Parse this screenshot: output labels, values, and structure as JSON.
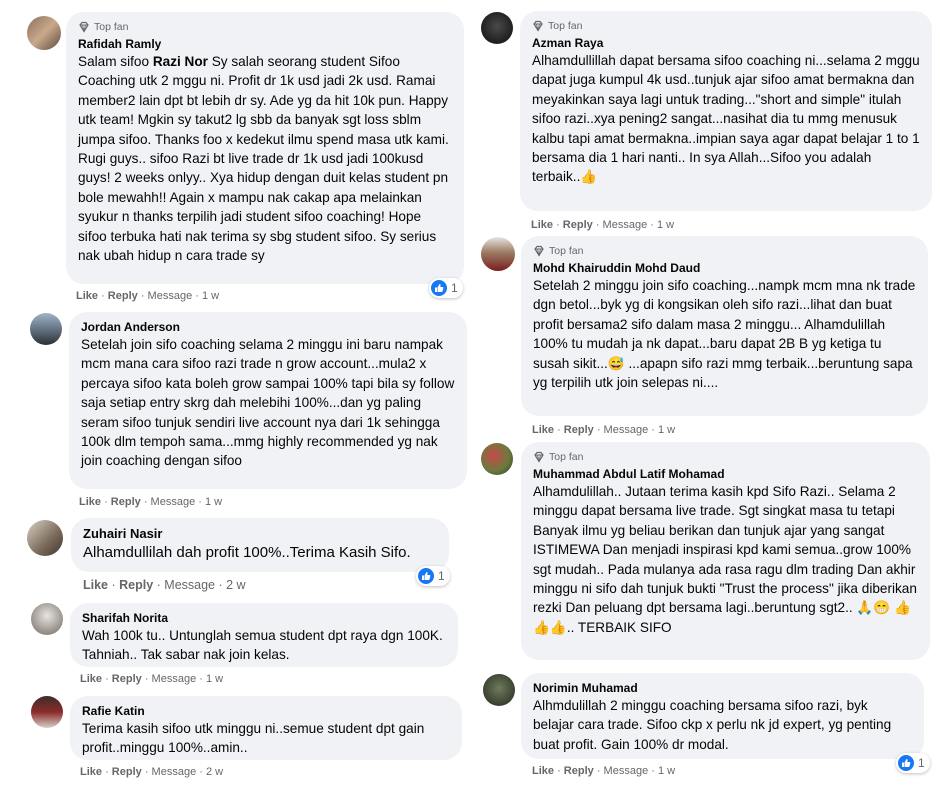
{
  "badge_label": "Top fan",
  "colors": {
    "bubble": "#f0f2f5",
    "like_blue": "#1877f2",
    "meta": "#65676b"
  },
  "comments": [
    {
      "name": "Rafidah Ramly",
      "mention": "Razi Nor",
      "text_prefix": "Salam sifoo ",
      "text": " Sy salah seorang student Sifoo Coaching utk 2 mggu ni. Profit dr 1k usd jadi 2k usd. Ramai member2 lain dpt bt lebih dr sy. Ade yg da hit 10k pun. Happy utk team! Mgkin sy takut2 lg sbb da banyak sgt loss sblm jumpa sifoo. Thanks foo x kedekut ilmu spend masa utk kami. Rugi guys.. sifoo Razi bt live trade dr 1k usd jadi 100kusd guys! 2 weeks onlyy.. Xya hidup dengan duit kelas student pn bole mewahh!! Again x mampu nak cakap apa melainkan syukur n thanks terpilih jadi student sifoo coaching! Hope sifoo terbuka hati nak terima sy sbg student sifoo. Sy serius nak ubah hidup n cara trade sy",
      "like": "Like",
      "reply": "Reply",
      "message": "Message",
      "time": "1 w",
      "reactions": "1"
    },
    {
      "name": "Jordan Anderson",
      "text": "Setelah join sifo coaching selama 2 minggu ini baru nampak mcm mana cara sifoo razi trade n grow account...mula2 x percaya sifoo kata boleh grow sampai 100% tapi bila sy follow saja setiap entry skrg dah melebihi 100%...dan yg paling seram sifoo tunjuk sendiri live account nya dari 1k sehingga 100k dlm tempoh sama...mmg highly recommended yg nak join coaching dengan sifoo",
      "like": "Like",
      "reply": "Reply",
      "message": "Message",
      "time": "1 w"
    },
    {
      "name": "Zuhairi Nasir",
      "text": "Alhamdullilah dah profit 100%..Terima Kasih Sifo.",
      "like": "Like",
      "reply": "Reply",
      "message": "Message",
      "time": "2 w",
      "reactions": "1"
    },
    {
      "name": "Sharifah Norita",
      "text": "Wah 100k tu.. Untunglah semua student dpt raya dgn 100K. Tahniah.. Tak sabar nak join kelas.",
      "like": "Like",
      "reply": "Reply",
      "message": "Message",
      "time": "1 w"
    },
    {
      "name": "Rafie Katin",
      "text": "Terima kasih sifoo utk minggu ni..semue student dpt gain profit..minggu 100%..amin..",
      "like": "Like",
      "reply": "Reply",
      "message": "Message",
      "time": "2 w"
    },
    {
      "name": "Azman Raya",
      "text": "Alhamdullillah dapat bersama sifoo coaching ni...selama 2 mggu dapat juga kumpul 4k usd..tunjuk ajar sifoo amat bermakna dan meyakinkan saya lagi untuk trading...\"short and simple\" itulah sifoo razi..xya pening2 sangat...nasihat dia tu mmg menusuk kalbu tapi amat bermakna..impian saya agar dapat belajar 1 to 1 bersama dia 1 hari nanti.. In sya Allah...Sifoo you adalah terbaik..👍",
      "like": "Like",
      "reply": "Reply",
      "message": "Message",
      "time": "1 w"
    },
    {
      "name": "Mohd Khairuddin Mohd Daud",
      "text": "Setelah 2 minggu join sifo coaching...nampk mcm mna nk trade dgn betol...byk yg di kongsikan oleh sifo razi...lihat dan buat profit bersama2 sifo dalam masa 2 minggu... Alhamdulillah 100% tu mudah ja nk dapat...baru dapat 2B B yg ketiga tu susah sikit...😅 ...apapn sifo razi mmg terbaik...beruntung sapa yg terpilih utk join selepas ni....",
      "like": "Like",
      "reply": "Reply",
      "message": "Message",
      "time": "1 w"
    },
    {
      "name": "Muhammad Abdul Latif Mohamad",
      "text": "Alhamdulillah.. Jutaan terima kasih kpd Sifo Razi.. Selama 2 minggu dapat bersama live trade. Sgt singkat masa tu tetapi Banyak ilmu yg beliau berikan dan tunjuk ajar yang sangat ISTIMEWA Dan menjadi inspirasi kpd kami semua..grow 100% sgt mudah.. Pada mulanya ada rasa ragu dlm trading Dan akhir minggu ni sifo dah tunjuk bukti \"Trust the process\" jika diberikan rezki Dan peluang dpt bersama lagi..beruntung sgt2.. 🙏😁 👍👍👍.. TERBAIK SIFO"
    },
    {
      "name": "Norimin Muhamad",
      "text": "Alhmdulillah 2 minggu coaching bersama sifoo razi, byk belajar cara trade. Sifoo ckp x perlu nk jd expert, yg penting buat profit. Gain 100% dr modal.",
      "like": "Like",
      "reply": "Reply",
      "message": "Message",
      "time": "1 w",
      "reactions": "1"
    }
  ]
}
